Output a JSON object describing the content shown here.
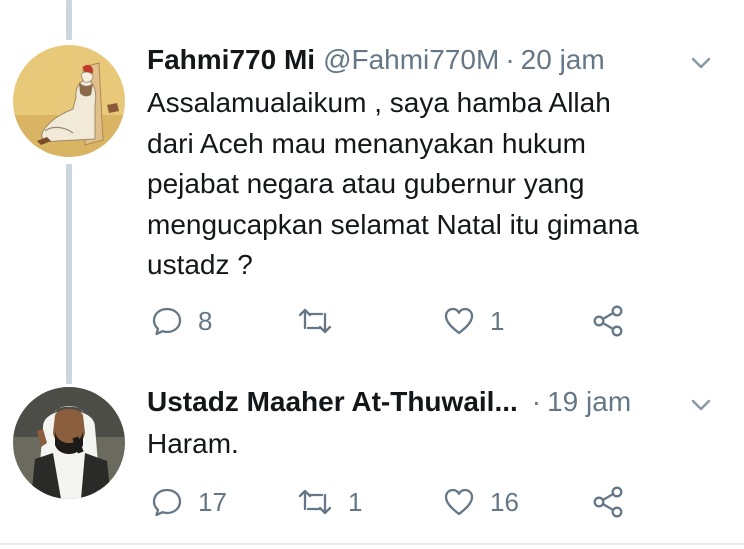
{
  "tweets": [
    {
      "display_name": "Fahmi770 Mi",
      "handle": "@Fahmi770M",
      "separator": "·",
      "time": "20 jam",
      "text_lines": [
        "Assalamualaikum , saya hamba Allah",
        "dari Aceh mau menanyakan hukum",
        "pejabat negara atau gubernur yang",
        "mengucapkan selamat Natal itu gimana",
        "ustadz ?"
      ],
      "replies": "8",
      "retweets": "",
      "likes": "1",
      "avatar_icon": "person-in-robe-painting",
      "avatar_bg": "#e6c777"
    },
    {
      "display_name": "Ustadz Maaher At-Thuwail...",
      "separator": "·",
      "time": "19 jam",
      "text_lines": [
        "Haram."
      ],
      "replies": "17",
      "retweets": "1",
      "likes": "16",
      "avatar_icon": "man-with-microphone-photo",
      "avatar_bg": "#5a5a52"
    }
  ],
  "icons": {
    "reply": "speech-bubble-icon",
    "retweet": "retweet-arrows-icon",
    "like": "heart-icon",
    "share": "share-nodes-icon",
    "menu": "chevron-down-icon"
  },
  "colors": {
    "text": "#14171a",
    "muted": "#657786",
    "thread_line": "#ccd6dd"
  }
}
